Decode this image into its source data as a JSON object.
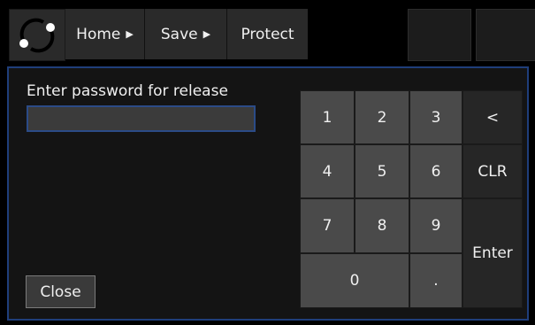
{
  "topbar": {
    "logo_icon": "circular-arrows-icon",
    "breadcrumb": [
      {
        "label": "Home"
      },
      {
        "label": "Save"
      },
      {
        "label": "Protect"
      }
    ]
  },
  "dialog": {
    "prompt": "Enter password for release",
    "password_value": "",
    "close_label": "Close"
  },
  "keypad": {
    "k1": "1",
    "k2": "2",
    "k3": "3",
    "k4": "4",
    "k5": "5",
    "k6": "6",
    "k7": "7",
    "k8": "8",
    "k9": "9",
    "k0": "0",
    "dot": ".",
    "backspace": "<",
    "clear": "CLR",
    "enter": "Enter"
  },
  "colors": {
    "accent_border": "#1f3e7a",
    "key_numeric": "#4a4a4a",
    "key_function": "#262626",
    "panel_bg": "#141414"
  }
}
